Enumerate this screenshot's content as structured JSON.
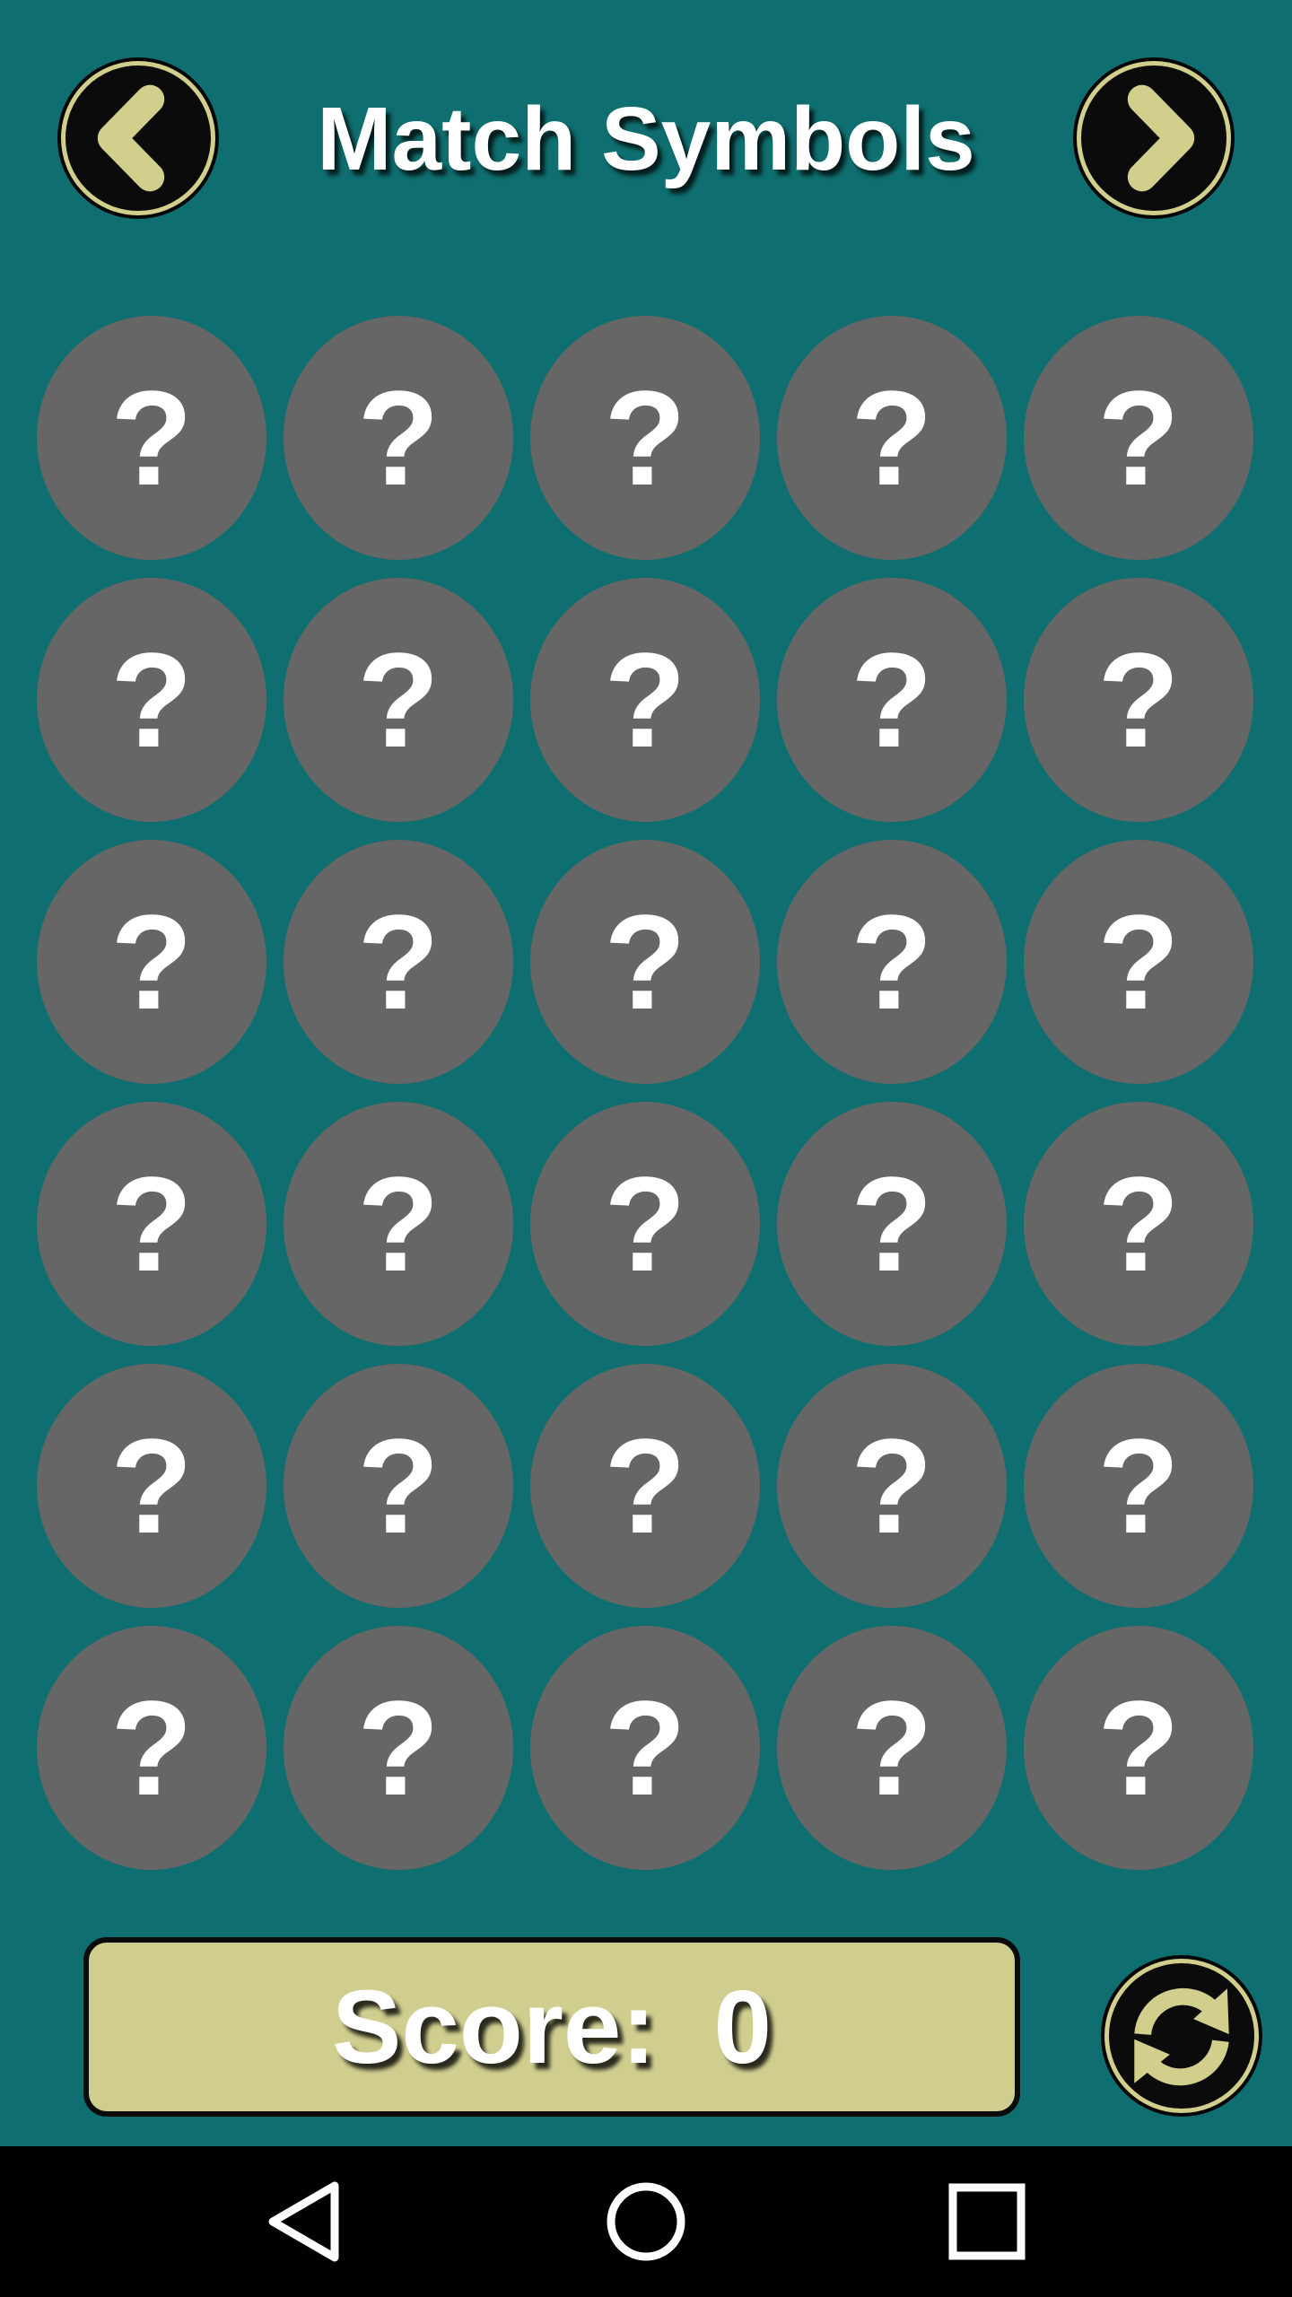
{
  "header": {
    "title": "Match Symbols",
    "prev_icon": "chevron-left-icon",
    "next_icon": "chevron-right-icon"
  },
  "board": {
    "rows": 6,
    "columns": 5,
    "tiles": [
      [
        "?",
        "?",
        "?",
        "?",
        "?"
      ],
      [
        "?",
        "?",
        "?",
        "?",
        "?"
      ],
      [
        "?",
        "?",
        "?",
        "?",
        "?"
      ],
      [
        "?",
        "?",
        "?",
        "?",
        "?"
      ],
      [
        "?",
        "?",
        "?",
        "?",
        "?"
      ],
      [
        "?",
        "?",
        "?",
        "?",
        "?"
      ]
    ]
  },
  "score": {
    "label": "Score:",
    "value": "0"
  },
  "restart": {
    "icon": "refresh-icon"
  },
  "system_nav": {
    "back_icon": "back-triangle-icon",
    "home_icon": "home-circle-icon",
    "recent_icon": "recent-apps-square-icon"
  },
  "colors": {
    "background": "#0f6e6f",
    "tile": "#666666",
    "accent": "#d2cf8c",
    "score_box": "#d0ce8f",
    "text": "#ffffff",
    "system_bar": "#000000"
  }
}
